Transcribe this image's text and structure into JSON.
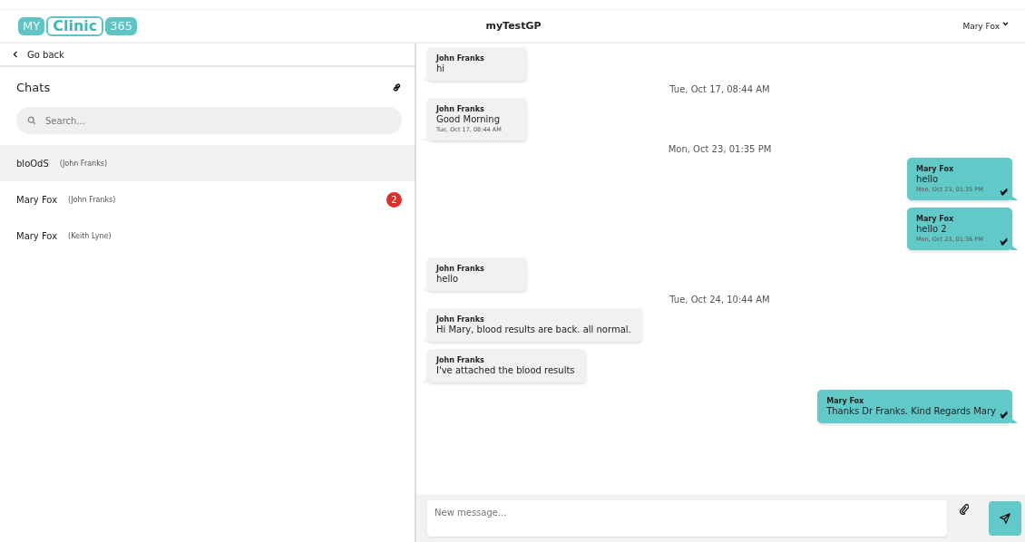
{
  "header": {
    "logo": [
      "MY",
      "Clinic",
      "365"
    ],
    "practice": "myTestGP",
    "user": "Mary Fox"
  },
  "sidebar": {
    "back": "Go back",
    "title": "Chats",
    "search": {
      "placeholder": "Search..."
    },
    "chats": [
      {
        "name": "bloOdS",
        "participant": "(John Franks)",
        "selected": true
      },
      {
        "name": "Mary Fox",
        "participant": "(John Franks)",
        "selected": false,
        "unread": "2"
      },
      {
        "name": "Mary Fox",
        "participant": "(Keith Lyne)",
        "selected": false
      }
    ]
  },
  "messages": [
    {
      "kind": "message",
      "outgoing": false,
      "sender": "John Franks",
      "text": "hi"
    },
    {
      "kind": "date",
      "text": "Tue, Oct 17, 08:44 AM"
    },
    {
      "kind": "message",
      "outgoing": false,
      "sender": "John Franks",
      "text": "Good Morning",
      "time": "Tue, Oct 17, 08:44 AM"
    },
    {
      "kind": "date",
      "text": "Mon, Oct 23, 01:35 PM"
    },
    {
      "kind": "message",
      "outgoing": true,
      "read": true,
      "sender": "Mary Fox",
      "text": "hello",
      "time": "Mon, Oct 23, 01:35 PM"
    },
    {
      "kind": "message",
      "outgoing": true,
      "read": true,
      "sender": "Mary Fox",
      "text": "hello 2",
      "time": "Mon, Oct 23, 01:36 PM"
    },
    {
      "kind": "message",
      "outgoing": false,
      "sender": "John Franks",
      "text": "hello"
    },
    {
      "kind": "date",
      "text": "Tue, Oct 24, 10:44 AM"
    },
    {
      "kind": "message",
      "outgoing": false,
      "sender": "John Franks",
      "text": "Hi Mary, blood results are back. all normal."
    },
    {
      "kind": "message",
      "outgoing": false,
      "sender": "John Franks",
      "text": "I've attached the blood results"
    },
    {
      "kind": "message",
      "outgoing": true,
      "read": true,
      "sender": "Mary Fox",
      "text": "Thanks Dr Franks. Kind Regards Mary"
    }
  ],
  "composer": {
    "placeholder": "New message..."
  }
}
